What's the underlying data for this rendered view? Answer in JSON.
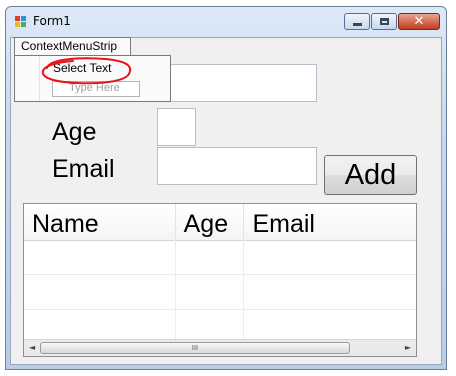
{
  "window": {
    "title": "Form1",
    "minimize_glyph": "",
    "maximize_glyph": "",
    "close_glyph": "✕"
  },
  "menu": {
    "strip_label": "ContextMenuStrip",
    "items": [
      {
        "label": "Select Text"
      }
    ],
    "new_item_placeholder": "Type Here"
  },
  "form": {
    "age_label": "Age",
    "email_label": "Email",
    "name_value": "",
    "age_value": "",
    "email_value": "",
    "add_button": "Add"
  },
  "grid": {
    "columns": [
      "Name",
      "Age",
      "Email"
    ],
    "rows": [
      [
        "",
        "",
        ""
      ],
      [
        "",
        "",
        ""
      ],
      [
        "",
        "",
        ""
      ]
    ],
    "scrollbar": {
      "left_arrow": "◄",
      "right_arrow": "►",
      "thumb_grip": "III"
    }
  },
  "colors": {
    "annotation_circle": "#e8141b"
  }
}
